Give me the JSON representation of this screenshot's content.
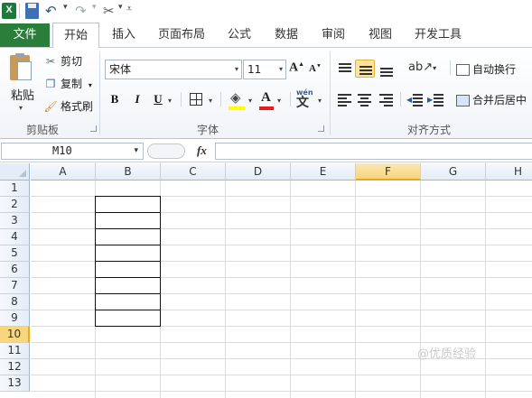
{
  "app": {
    "name": "Microsoft Excel"
  },
  "quick_access": {
    "icons": [
      "excel-logo-icon",
      "save-icon",
      "undo-icon",
      "redo-icon",
      "tools-icon",
      "customize-icon"
    ]
  },
  "tabs": [
    {
      "label": "文件",
      "active": false
    },
    {
      "label": "开始",
      "active": true
    },
    {
      "label": "插入",
      "active": false
    },
    {
      "label": "页面布局",
      "active": false
    },
    {
      "label": "公式",
      "active": false
    },
    {
      "label": "数据",
      "active": false
    },
    {
      "label": "审阅",
      "active": false
    },
    {
      "label": "视图",
      "active": false
    },
    {
      "label": "开发工具",
      "active": false
    }
  ],
  "clipboard": {
    "paste_label": "粘贴",
    "cut_label": "剪切",
    "copy_label": "复制",
    "format_painter_label": "格式刷",
    "group_label": "剪贴板"
  },
  "font": {
    "name": "宋体",
    "size": "11",
    "bold": "B",
    "italic": "I",
    "underline": "U",
    "grow": "A",
    "shrink": "A",
    "font_color_glyph": "A",
    "phonetic": "wén",
    "group_label": "字体",
    "fill_color": "#ffff00",
    "text_color": "#e81c1c"
  },
  "alignment": {
    "wrap_label": "自动换行",
    "merge_label": "合并后居中",
    "group_label": "对齐方式",
    "active_button": "middle-align"
  },
  "formula_bar": {
    "name_box": "M10",
    "fx": "fx",
    "formula": ""
  },
  "sheet": {
    "columns": [
      "A",
      "B",
      "C",
      "D",
      "E",
      "F",
      "G",
      "H"
    ],
    "rows": [
      "1",
      "2",
      "3",
      "4",
      "5",
      "6",
      "7",
      "8",
      "9",
      "10",
      "11",
      "12",
      "13"
    ],
    "active_column": "F",
    "active_row": "10",
    "bordered_range": "B2:B9"
  },
  "watermark": "@优质经验"
}
